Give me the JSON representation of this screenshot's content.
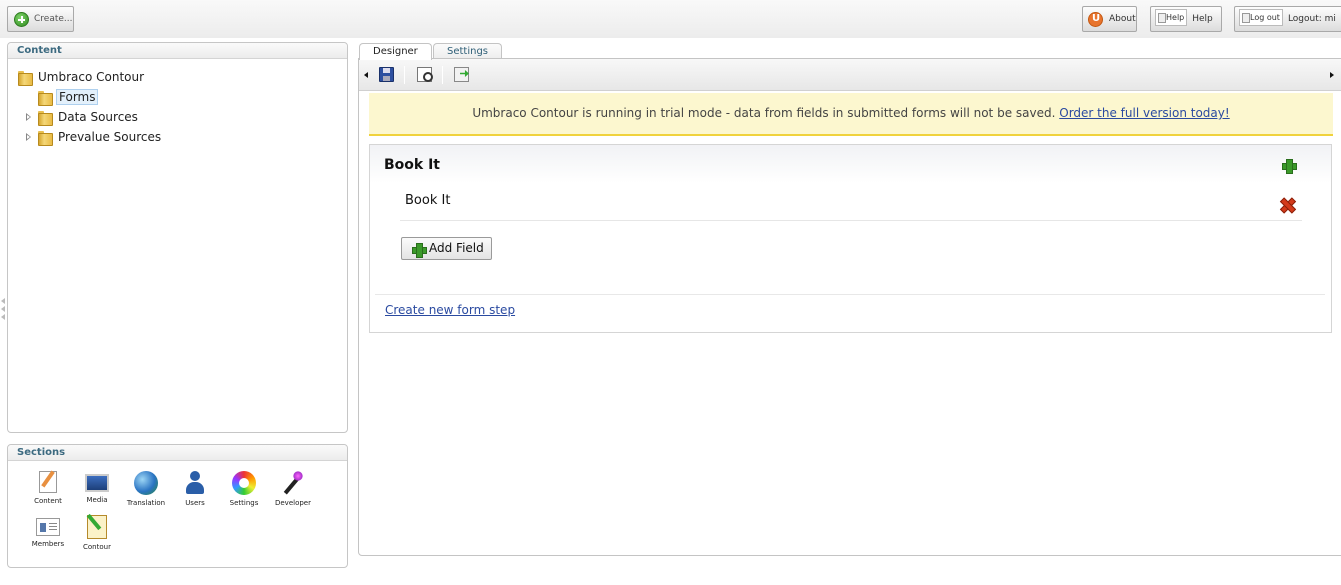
{
  "topbar": {
    "create_label": "Create...",
    "about_label": "About",
    "help_img_alt": "Help",
    "help_label": "Help",
    "logout_img_alt": "Log out",
    "logout_label": "Logout: mi"
  },
  "content_panel": {
    "title": "Content",
    "tree": {
      "root": "Umbraco Contour",
      "children": [
        "Forms",
        "Data Sources",
        "Prevalue Sources"
      ],
      "selected": "Forms"
    }
  },
  "sections_panel": {
    "title": "Sections",
    "items": [
      "Content",
      "Media",
      "Translation",
      "Users",
      "Settings",
      "Developer",
      "Members",
      "Contour"
    ]
  },
  "tabs": [
    "Designer",
    "Settings"
  ],
  "active_tab": "Designer",
  "toolbar": {
    "icons": [
      "save-icon",
      "preview-icon",
      "export-icon"
    ]
  },
  "trial_notice": {
    "text": "Umbraco Contour is running in trial mode - data from fields in submitted forms will not be saved.",
    "link": "Order the full version today!"
  },
  "form": {
    "page_title": "Book It",
    "fieldset_title": "Book It",
    "add_field_label": "Add Field",
    "create_step_link": "Create new form step"
  },
  "colors": {
    "accent_link": "#2a4aa0",
    "panel_heading": "#3c6a80",
    "trial_background": "#fcf7cf",
    "trial_border": "#f0d23c"
  }
}
